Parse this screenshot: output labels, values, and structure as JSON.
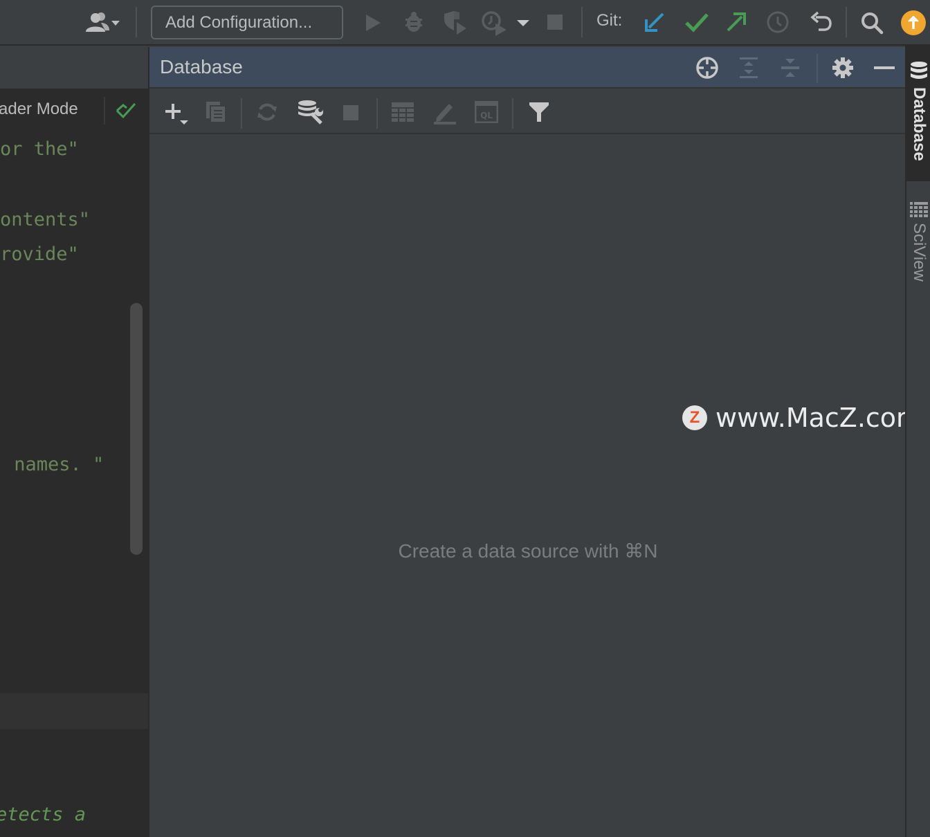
{
  "toolbar": {
    "add_configuration_label": "Add Configuration...",
    "git_label": "Git:",
    "icons": {
      "vcs_user": "users-icon",
      "run": "run-icon",
      "debug": "bug-icon",
      "coverage": "coverage-icon",
      "profile": "profiler-icon",
      "more_runs": "chevron-down-icon",
      "stop": "stop-icon",
      "git_update": "arrow-down-left-icon",
      "git_commit": "check-icon",
      "git_push": "arrow-up-right-icon",
      "git_history": "clock-icon",
      "git_rollback": "undo-icon",
      "search": "search-icon",
      "update_available": "arrow-up-circle-icon"
    },
    "colors": {
      "git_update": "#3592c4",
      "git_commit": "#499c54",
      "git_push": "#499c54",
      "update_badge": "#f0a732"
    }
  },
  "editor": {
    "reader_mode_label": "ader Mode",
    "code_lines": [
      "or the\"",
      "ontents\"",
      "rovide\"",
      " names. \"",
      "etects a"
    ]
  },
  "database_panel": {
    "title": "Database",
    "empty_text": "Create a data source with ⌘N",
    "header_icons": [
      "crosshair-icon",
      "expand-all-icon",
      "collapse-all-icon",
      "gear-icon",
      "minimize-icon"
    ],
    "toolbar_icons": [
      "add-icon",
      "duplicate-icon",
      "refresh-icon",
      "data-source-properties-icon",
      "stop-icon",
      "table-icon",
      "edit-icon",
      "query-console-icon",
      "filter-icon"
    ]
  },
  "right_strip": {
    "tabs": [
      {
        "label": "Database",
        "active": true
      },
      {
        "label": "SciView",
        "active": false
      }
    ]
  },
  "watermark": {
    "logo_letter": "Z",
    "text": "www.MacZ.com"
  }
}
